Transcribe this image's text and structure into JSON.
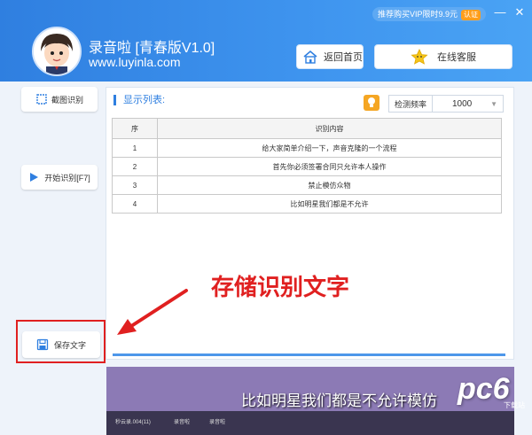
{
  "header": {
    "vip_text": "推荐购买VIP限时9.9元",
    "vip_badge": "认证",
    "app_title": "录音啦  [青春版V1.0]",
    "app_url": "www.luyinla.com",
    "home_button": "返回首页",
    "service_button": "在线客服"
  },
  "window_controls": {
    "minimize": "—",
    "close": "✕"
  },
  "sidebar": {
    "capture_button": "截图识别",
    "start_button": "开始识别[F7]",
    "save_button": "保存文字"
  },
  "panel": {
    "title": "显示列表:",
    "freq_label": "检测频率",
    "freq_value": "1000",
    "table": {
      "headers": [
        "序",
        "识别内容"
      ],
      "rows": [
        [
          "1",
          "给大家简单介绍一下，声音克隆的一个流程"
        ],
        [
          "2",
          "首先你必须签署合同只允许本人操作"
        ],
        [
          "3",
          "禁止模仿众物"
        ],
        [
          "4",
          "比如明星我们都是不允许"
        ]
      ]
    }
  },
  "annotation": {
    "caption": "存储识别文字",
    "color": "#e02020"
  },
  "video": {
    "subtitle": "比如明星我们都是不允许模仿",
    "taskbar_items": [
      "秒云录.004(11)",
      "录音啦",
      "录音啦"
    ]
  },
  "watermark": {
    "text": "pc6",
    "sub": "下载站"
  },
  "colors": {
    "accent": "#2f7fe0",
    "header": "#3f95ef"
  }
}
